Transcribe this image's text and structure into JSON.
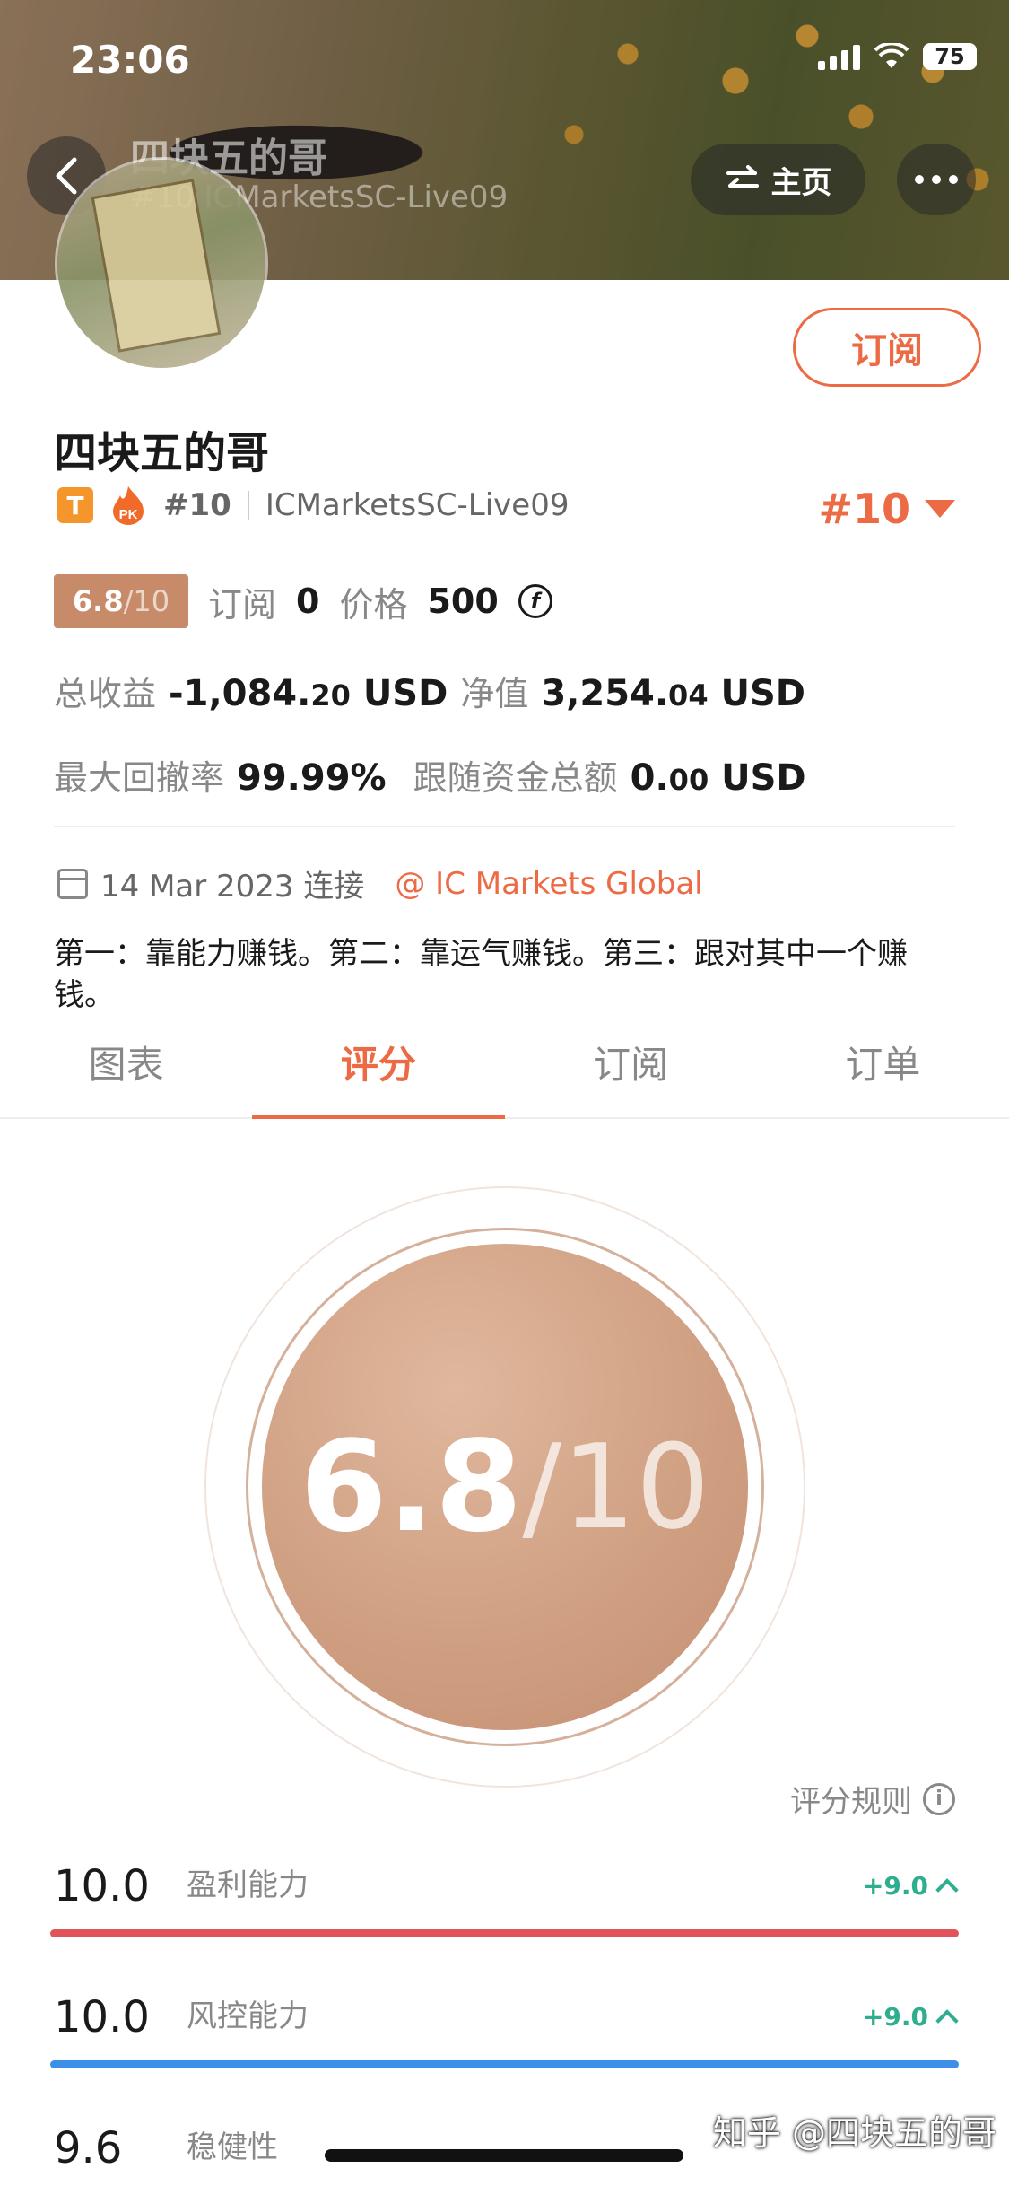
{
  "status_bar": {
    "time": "23:06",
    "battery": "75"
  },
  "header": {
    "title": "四块五的哥",
    "subtitle": "#10 ICMarketsSC-Live09",
    "home_label": "主页"
  },
  "profile": {
    "subscribe_label": "订阅",
    "name": "四块五的哥",
    "tier_badge": "T",
    "pk_badge": "PK",
    "rank_small": "#10",
    "server": "ICMarketsSC-Live09",
    "rank_big": "#10",
    "score": "6.8",
    "score_den": "/10",
    "subscribe_count_label": "订阅",
    "subscribe_count": "0",
    "price_label": "价格",
    "price": "500",
    "price_coin": "f",
    "total_profit_label": "总收益",
    "total_profit_main": "-1,084.",
    "total_profit_dec": "20",
    "total_profit_unit": "USD",
    "equity_label": "净值",
    "equity_main": "3,254.",
    "equity_dec": "04",
    "equity_unit": "USD",
    "max_drawdown_label": "最大回撤率",
    "max_drawdown": "99.99%",
    "follow_total_label": "跟随资金总额",
    "follow_total_main": "0.",
    "follow_total_dec": "00",
    "follow_total_unit": "USD",
    "connect_date": "14 Mar 2023 连接",
    "broker": "@ IC Markets Global",
    "bio": "第一：靠能力赚钱。第二：靠运气赚钱。第三：跟对其中一个赚钱。"
  },
  "tabs": [
    {
      "label": "图表",
      "active": false
    },
    {
      "label": "评分",
      "active": true
    },
    {
      "label": "订阅",
      "active": false
    },
    {
      "label": "订单",
      "active": false
    }
  ],
  "rating": {
    "score": "6.8",
    "den": "/10",
    "rules_label": "评分规则",
    "metrics": [
      {
        "value": "10.0",
        "label": "盈利能力",
        "delta": "+9.0",
        "color": "#e0545a"
      },
      {
        "value": "10.0",
        "label": "风控能力",
        "delta": "+9.0",
        "color": "#3d8ee6"
      },
      {
        "value": "9.6",
        "label": "稳健性",
        "delta": "",
        "color": "#f0a23b"
      }
    ]
  },
  "watermark": "知乎 @四块五的哥",
  "colors": {
    "accent": "#ec6b45",
    "positive": "#2fae8f",
    "chip": "#c78b6a"
  }
}
